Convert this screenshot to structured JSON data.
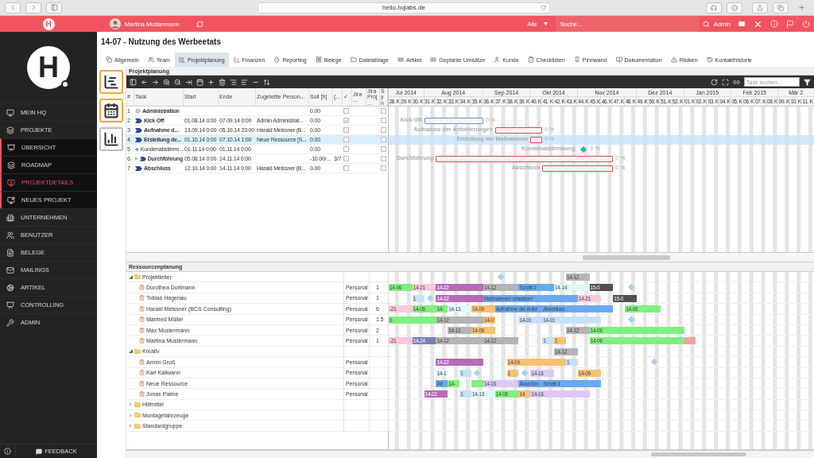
{
  "browser": {
    "url": "hello.hqlabs.de"
  },
  "topbar": {
    "logo": "H",
    "user": "Martina Mustermann",
    "scope": "Alle",
    "search_placeholder": "Suche...",
    "admin": "Admin"
  },
  "sidebar": {
    "logo": "H",
    "items": [
      {
        "label": "MEIN HQ",
        "selected": false
      },
      {
        "label": "PROJEKTE",
        "selected": false,
        "children": [
          {
            "label": "ÜBERSICHT",
            "selected": false
          },
          {
            "label": "ROADMAP",
            "selected": false
          },
          {
            "label": "PROJEKTDETAILS",
            "selected": true
          },
          {
            "label": "NEUES PROJEKT",
            "selected": false
          }
        ]
      },
      {
        "label": "UNTERNEHMEN",
        "selected": false
      },
      {
        "label": "BENUTZER",
        "selected": false
      },
      {
        "label": "BELEGE",
        "selected": false
      },
      {
        "label": "MAILINGS",
        "selected": false
      },
      {
        "label": "ARTIKEL",
        "selected": false
      },
      {
        "label": "CONTROLLING",
        "selected": false
      },
      {
        "label": "ADMIN",
        "selected": false
      }
    ],
    "feedback": "FEEDBACK"
  },
  "page": {
    "title": "14-07 - Nutzung des Werbeetats"
  },
  "tabs": [
    {
      "label": "Allgemein",
      "selected": false
    },
    {
      "label": "Team",
      "selected": false
    },
    {
      "label": "Projektplanung",
      "selected": true
    },
    {
      "label": "Finanzen",
      "selected": false
    },
    {
      "label": "Reporting",
      "selected": false
    },
    {
      "label": "Belege",
      "selected": false
    },
    {
      "label": "Dateiablage",
      "selected": false
    },
    {
      "label": "Artikel",
      "selected": false
    },
    {
      "label": "Geplante Umsätze",
      "selected": false
    },
    {
      "label": "Kunde",
      "selected": false
    },
    {
      "label": "Checklisten",
      "selected": false
    },
    {
      "label": "Pinnwand",
      "selected": false
    },
    {
      "label": "Dokumentation",
      "selected": false
    },
    {
      "label": "Risiken",
      "selected": false
    },
    {
      "label": "Kontakthistorie",
      "selected": false
    }
  ],
  "views": [
    {
      "selected": true
    },
    {
      "selected": true
    },
    {
      "selected": false
    }
  ],
  "planning": {
    "title": "Projektplanung",
    "task_search_placeholder": "Task suchen...",
    "columns": [
      "#",
      "Task",
      "Start",
      "Ende",
      "Zugeteilte Person...",
      "Soll [h]",
      "(...",
      "✓",
      "Jira ...",
      "Jira Proj...",
      "Syn"
    ],
    "rows": [
      {
        "no": "1",
        "task": "Administration",
        "kind": "group",
        "soll": "0.00",
        "done": false,
        "sync": false,
        "selected": false
      },
      {
        "no": "2",
        "task": "Kick Off",
        "kind": "task",
        "start": "01.08.14 0:00",
        "end": "07.09.14 0:00",
        "person": "Admin Administrat...",
        "soll": "0.00",
        "done": true,
        "sync": false,
        "selected": false,
        "bar": {
          "label": "Kick Off",
          "percent": "0 %"
        }
      },
      {
        "no": "3",
        "task": "Aufnahme d...",
        "kind": "task",
        "start": "13.09.14 0:00",
        "end": "05.10.14 23:00",
        "person": "Harald Meissner (B...",
        "soll": "0.00",
        "done": false,
        "sync": false,
        "selected": false,
        "bar": {
          "label": "Aufnahme der Anforderungen",
          "percent": "0 %"
        }
      },
      {
        "no": "4",
        "task": "Erstellung de...",
        "kind": "task",
        "start": "01.10.14 0:00",
        "end": "07.10.14 1:00",
        "person": "Neue Ressource [S...",
        "soll": "0.00",
        "done": false,
        "sync": false,
        "selected": true,
        "bar": {
          "label": "Erstellung der Maßnahmen",
          "percent": "0 %"
        }
      },
      {
        "no": "5",
        "task": "Kundenabstimm...",
        "kind": "milestone",
        "start": "01.11.14 0:00",
        "end": "01.11.14 0:00",
        "soll": "0.00",
        "done": false,
        "sync": false,
        "selected": false,
        "bar": {
          "label": "Kundenabstimmung",
          "percent": "0 %"
        }
      },
      {
        "no": "6",
        "task": "Durchführung",
        "kind": "summary",
        "start": "05.08.14 0:00",
        "end": "14.11.14 0:00",
        "soll": "-10.00/...",
        "extra": "3/7",
        "done": false,
        "sync": false,
        "selected": false,
        "bar": {
          "label": "Durchführung",
          "percent": "0 %"
        }
      },
      {
        "no": "7",
        "task": "Abschluss",
        "kind": "task",
        "start": "12.10.14 0:00",
        "end": "14.11.14 0:00",
        "person": "Harald Meissner (B...",
        "soll": "0.00",
        "done": false,
        "sync": false,
        "selected": false,
        "bar": {
          "label": "Abschluss",
          "percent": "0 %"
        }
      }
    ]
  },
  "timeline": {
    "months": [
      "Jul 2014",
      "Aug 2014",
      "Sep 2014",
      "Okt 2014",
      "Nov 2014",
      "Dez 2014",
      "Jan 2015",
      "Feb 2015",
      "Mär 2"
    ],
    "weeks": [
      "28. K",
      "29. K",
      "30. K",
      "31. K",
      "32. K",
      "33. K",
      "34. K",
      "35. K",
      "36. K",
      "37. K",
      "38. K",
      "39. K",
      "40. K",
      "41. K",
      "42. K",
      "43. K",
      "44. K",
      "45. K",
      "46. K",
      "47. K",
      "48. K",
      "49. K",
      "50. K",
      "51. K",
      "52. K",
      "01. K",
      "02. K",
      "03. K",
      "04. K",
      "05. K",
      "06. K",
      "07. K",
      "08. K",
      "09. K",
      "10. K",
      "11. K"
    ]
  },
  "resources": {
    "title": "Ressourcenplanung",
    "groups": [
      {
        "name": "Projektleiter",
        "expanded": true,
        "bars": [
          {
            "kind": "milestone",
            "color": "#a8cff0"
          },
          {
            "kind": "bar",
            "label": "14-12",
            "color": "#b4b4b4"
          }
        ],
        "children": [
          {
            "name": "Dorothea Dortmann",
            "type": "Personal",
            "count": "1",
            "bars": [
              {
                "kind": "bar",
                "label": "14-06",
                "color": "#7ef07e"
              },
              {
                "kind": "bar",
                "label": "14-21",
                "color": "#f8c8dc"
              },
              {
                "kind": "bar",
                "label": "14-22",
                "color": "#b46cb8"
              },
              {
                "kind": "bar",
                "label": "14-12",
                "color": "#b4b4b4"
              },
              {
                "kind": "bar",
                "label": "Schritt 2",
                "color": "#6aa8f0"
              },
              {
                "kind": "bar",
                "label": "14-14",
                "color": "#dff8fa"
              },
              {
                "kind": "bar",
                "label": "15-0",
                "color": "#505050"
              },
              {
                "kind": "milestone",
                "color": "#a8cff0"
              }
            ]
          },
          {
            "name": "Tobias Hagenau",
            "type": "Personal",
            "count": "1",
            "bars": [
              {
                "kind": "bar",
                "label": "1",
                "color": "#c8e0f8"
              },
              {
                "kind": "milestone",
                "color": "#a8cff0"
              },
              {
                "kind": "bar",
                "label": "14-22",
                "color": "#b46cb8"
              },
              {
                "kind": "bar",
                "label": "Maßnahmen umsetzen",
                "color": "#6aa8f0"
              },
              {
                "kind": "bar",
                "label": "14-21",
                "color": "#f8c8dc"
              },
              {
                "kind": "bar",
                "label": "15-0",
                "color": "#505050"
              }
            ]
          },
          {
            "name": "Harald Meissner (BCS Consulting)",
            "type": "Personal",
            "count": "6",
            "bars": [
              {
                "kind": "bar",
                "label": "-21",
                "color": "#f8c8dc"
              },
              {
                "kind": "bar",
                "label": "14-06",
                "color": "#7ef07e"
              },
              {
                "kind": "bar",
                "label": "14-",
                "color": "#7ef07e"
              },
              {
                "kind": "bar",
                "label": "14-13",
                "color": "#dff8fa"
              },
              {
                "kind": "bar",
                "label": "14-09",
                "color": "#f8c070"
              },
              {
                "kind": "bar",
                "label": "Aufnahme der Anfor",
                "color": "#6aa8f0"
              },
              {
                "kind": "bar",
                "label": "Abschluss",
                "color": "#6aa8f0"
              },
              {
                "kind": "bar",
                "label": "14-06",
                "color": "#7ef07e"
              }
            ]
          },
          {
            "name": "Manfred Müller",
            "type": "Personal",
            "count": "1.5",
            "bars": [
              {
                "kind": "bar",
                "label": "6",
                "color": "#7ef07e"
              },
              {
                "kind": "bar",
                "label": "14-12",
                "color": "#b4b4b4"
              },
              {
                "kind": "bar",
                "label": "14-0",
                "color": "#f8c070"
              },
              {
                "kind": "bar",
                "label": "14-01",
                "color": "#c8e0f8"
              },
              {
                "kind": "bar",
                "label": "14-01",
                "color": "#c8e0f8"
              },
              {
                "kind": "milestone",
                "color": "#a8cff0"
              }
            ]
          },
          {
            "name": "Max Mustermann",
            "type": "Personal",
            "count": "2",
            "bars": [
              {
                "kind": "bar",
                "label": "14-12",
                "color": "#b4b4b4"
              },
              {
                "kind": "bar",
                "label": "14-09",
                "color": "#f8c070"
              },
              {
                "kind": "bar",
                "label": "14-12",
                "color": "#b4b4b4"
              },
              {
                "kind": "bar",
                "label": "14-06",
                "color": "#7ef07e"
              }
            ]
          },
          {
            "name": "Martina Mustermann",
            "type": "Personal",
            "count": "1",
            "bars": [
              {
                "kind": "bar",
                "label": "-21",
                "color": "#f8c8dc"
              },
              {
                "kind": "bar",
                "label": "14-24",
                "color": "#7c80b8"
              },
              {
                "kind": "bar",
                "label": "14-12",
                "color": "#b4b4b4"
              },
              {
                "kind": "bar",
                "label": "14-12",
                "color": "#b4b4b4"
              },
              {
                "kind": "bar",
                "label": "1",
                "color": "#c8e0f8"
              },
              {
                "kind": "bar",
                "label": "1",
                "color": "#f8c070"
              },
              {
                "kind": "bar",
                "label": "14-06",
                "color": "#7ef07e"
              },
              {
                "kind": "bar",
                "color": "#f0a0a0"
              }
            ]
          }
        ]
      },
      {
        "name": "Kreativ",
        "expanded": true,
        "bars": [
          {
            "kind": "bar",
            "label": "14-12",
            "color": "#b4b4b4"
          }
        ],
        "children": [
          {
            "name": "Armin Groß",
            "type": "Personal",
            "bars": [
              {
                "kind": "bar",
                "label": "14-22",
                "color": "#b46cb8"
              },
              {
                "kind": "bar",
                "label": "14-09",
                "color": "#f8c070"
              },
              {
                "kind": "bar",
                "label": "1",
                "color": "#c8e0f8"
              },
              {
                "kind": "milestone",
                "color": "#a8cff0"
              }
            ]
          },
          {
            "name": "Karl Kallwann",
            "type": "Personal",
            "bars": [
              {
                "kind": "bar",
                "label": "14-1",
                "color": "#dff8fa"
              },
              {
                "kind": "bar",
                "label": "1",
                "color": "#c8e0f8"
              },
              {
                "kind": "milestone",
                "color": "#a8cff0"
              },
              {
                "kind": "bar",
                "label": "1",
                "color": "#f8c070"
              },
              {
                "kind": "milestone",
                "color": "#a8cff0"
              },
              {
                "kind": "bar",
                "label": "14-16",
                "color": "#dcc8f4"
              },
              {
                "kind": "bar",
                "label": "14-09",
                "color": "#f8c070"
              }
            ]
          },
          {
            "name": "Neue Ressource",
            "type": "Personal",
            "bars": [
              {
                "kind": "bar",
                "label": "Art",
                "color": "#6aa8f0"
              },
              {
                "kind": "bar",
                "label": "14-",
                "color": "#7ef07e"
              },
              {
                "kind": "bar",
                "color": "#7ef07e"
              },
              {
                "kind": "bar",
                "label": "14-16",
                "color": "#dcc8f4"
              },
              {
                "kind": "bar",
                "label": "Ausw",
                "color": "#6aa8f0"
              },
              {
                "kind": "bar",
                "label": "Ern",
                "color": "#6aa8f0"
              },
              {
                "kind": "bar",
                "label": "Schritt 3",
                "color": "#6aa8f0"
              }
            ]
          },
          {
            "name": "Jonas Palme",
            "type": "Personal",
            "bars": [
              {
                "kind": "bar",
                "label": "14-22",
                "color": "#b46cb8"
              },
              {
                "kind": "bar",
                "label": "1",
                "color": "#c8e0f8"
              },
              {
                "kind": "bar",
                "label": "14-13",
                "color": "#dff8fa"
              },
              {
                "kind": "bar",
                "label": "14-06",
                "color": "#7ef07e"
              },
              {
                "kind": "bar",
                "label": "14",
                "color": "#f8c070"
              },
              {
                "kind": "bar",
                "label": "14-16",
                "color": "#dcc8f4"
              }
            ]
          }
        ]
      },
      {
        "name": "Hilfmittel",
        "expanded": false
      },
      {
        "name": "Montagefahrzeuge",
        "expanded": false
      },
      {
        "name": "Standardgruppe",
        "expanded": false
      }
    ]
  }
}
